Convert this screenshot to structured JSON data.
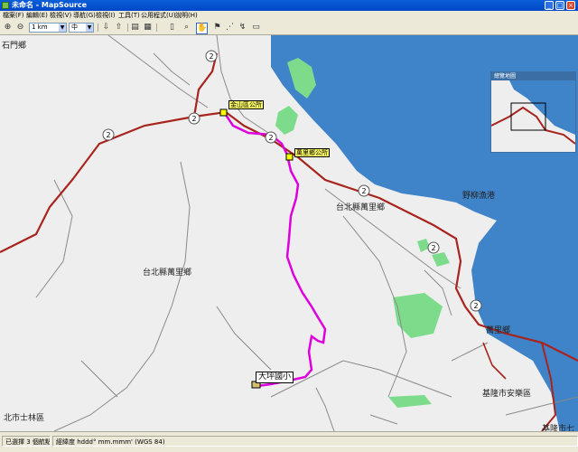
{
  "window": {
    "title": "未命名 - MapSource"
  },
  "menu": [
    "檔案(F)",
    "編輯(E)",
    "檢視(V)",
    "導航(G)",
    "檢視(I)",
    "工具(T)",
    "公用程式(U)",
    "說明(H)"
  ],
  "toolbar": {
    "zoom_level": "1 km",
    "detail": "中"
  },
  "overview": {
    "title": "總覽地圖"
  },
  "map": {
    "places": {
      "shimen": "石門鄉",
      "wanli_north": "台北縣萬里鄉",
      "wanli_west": "台北縣萬里鄉",
      "yeliu": "野柳漁港",
      "shilin": "北市士林區",
      "anle": "基隆市安樂區",
      "wanli_right": "萬里鄉",
      "qidu": "基隆市七"
    },
    "waypoints": {
      "jinshan": "金山區公所",
      "wanli_office": "萬里鄉公所"
    },
    "callout": "大坪國小",
    "route_numbers": [
      "2",
      "2",
      "2",
      "2",
      "2",
      "2",
      "2"
    ]
  },
  "status": {
    "left": "已選擇 3 個航點 個",
    "right": "經緯度 hddd° mm.mmm' (WGS 84)"
  }
}
